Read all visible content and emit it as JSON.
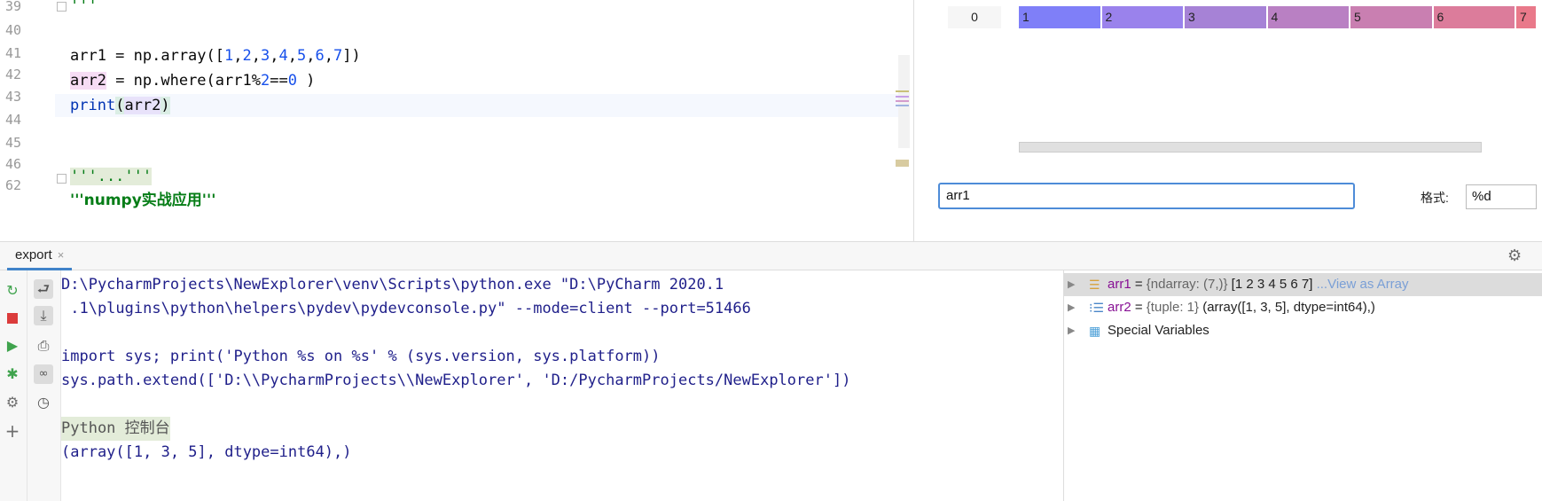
{
  "editor": {
    "lines": [
      {
        "num": "39",
        "text": "'''"
      },
      {
        "num": "40",
        "text": ""
      },
      {
        "num": "41",
        "text": "arr1 = np.array([1,2,3,4,5,6,7])"
      },
      {
        "num": "42",
        "text": "arr2 = np.where(arr1%2==0 )"
      },
      {
        "num": "43",
        "text": "print(arr2)"
      },
      {
        "num": "44",
        "text": ""
      },
      {
        "num": "45",
        "text": ""
      },
      {
        "num": "46",
        "text": "'''...'''"
      },
      {
        "num": "62",
        "text": "'''numpy实战应用'''"
      }
    ]
  },
  "array_viewer": {
    "row_index": "0",
    "cells": [
      "1",
      "2",
      "3",
      "4",
      "5",
      "6",
      "7"
    ],
    "cell_colors": [
      "#7f7ff8",
      "#9a82ec",
      "#a682d6",
      "#b980c3",
      "#c97fb1",
      "#dc7c9b",
      "#e9798a"
    ],
    "slice_value": "arr1",
    "format_label": "格式:",
    "format_value": "%d"
  },
  "tool_window": {
    "tab_label": "export",
    "close_glyph": "×"
  },
  "console": {
    "lines": [
      "D:\\PycharmProjects\\NewExplorer\\venv\\Scripts\\python.exe \"D:\\PyCharm 2020.1",
      " .1\\plugins\\python\\helpers\\pydev\\pydevconsole.py\" --mode=client --port=51466",
      "",
      "import sys; print('Python %s on %s' % (sys.version, sys.platform))",
      "sys.path.extend(['D:\\\\PycharmProjects\\\\NewExplorer', 'D:/PycharmProjects/NewExplorer'])",
      "",
      "Python 控制台",
      "(array([1, 3, 5], dtype=int64),)"
    ]
  },
  "variables": [
    {
      "name": "arr1",
      "sep": " = ",
      "type": "{ndarray: (7,)}",
      "value": " [1 2 3 4 5 6 7]",
      "link": " ...View as Array"
    },
    {
      "name": "arr2",
      "sep": " = ",
      "type": "{tuple: 1}",
      "value": " (array([1, 3, 5], dtype=int64),)",
      "link": ""
    },
    {
      "name": "Special Variables",
      "sep": "",
      "type": "",
      "value": "",
      "link": ""
    }
  ],
  "icons": {
    "rerun": "rerun-icon",
    "stop": "stop-icon",
    "run": "run-icon",
    "debug": "debug-icon",
    "settings": "settings-icon",
    "add": "add-icon",
    "soft_wrap": "soft-wrap-icon",
    "scroll_end": "scroll-to-end-icon",
    "print": "print-icon",
    "show_vars": "show-variables-icon",
    "history": "history-icon",
    "gear": "gear-icon"
  },
  "colors": {
    "accent": "#4083c9",
    "keyword_blue": "#0033b3",
    "number": "#1750eb",
    "string": "#067d17",
    "var_name": "#871094"
  }
}
